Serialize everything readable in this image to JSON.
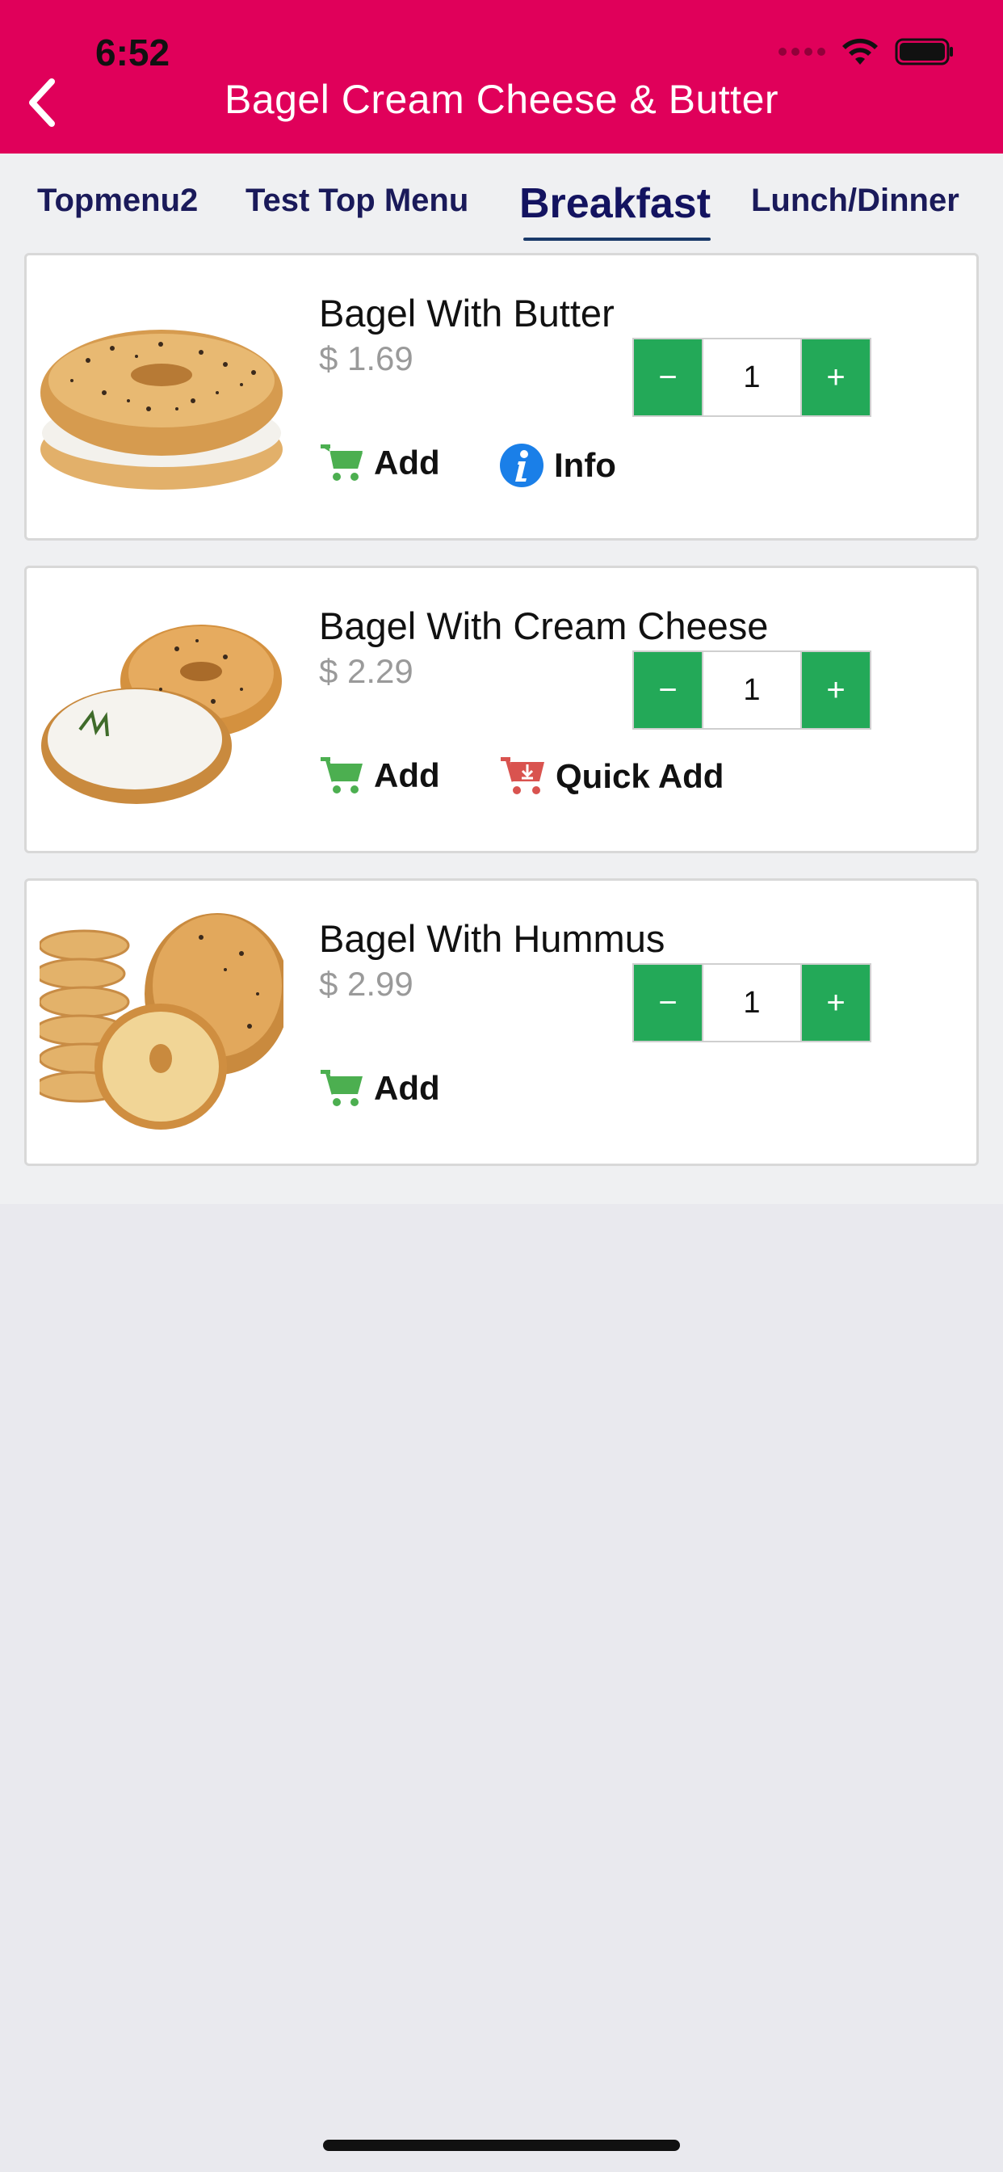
{
  "status_bar": {
    "time": "6:52"
  },
  "header": {
    "title": "Bagel Cream Cheese & Butter"
  },
  "tabs": [
    {
      "label": "Topmenu2"
    },
    {
      "label": "Test Top Menu"
    },
    {
      "label": "Breakfast"
    },
    {
      "label": "Lunch/Dinner"
    }
  ],
  "active_tab": "Breakfast",
  "items": [
    {
      "name": "Bagel With Butter",
      "price": "$ 1.69",
      "quantity": "1",
      "add_label": "Add",
      "extra_label": "Info"
    },
    {
      "name": "Bagel With Cream Cheese",
      "price": "$ 2.29",
      "quantity": "1",
      "add_label": "Add",
      "extra_label": "Quick Add"
    },
    {
      "name": "Bagel With Hummus",
      "price": "$ 2.99",
      "quantity": "1",
      "add_label": "Add"
    }
  ],
  "stepper": {
    "minus": "−",
    "plus": "+"
  },
  "colors": {
    "header": "#e0005a",
    "stepper_green": "#23a958",
    "cart_green": "#4caf50",
    "quick_add_red": "#d9534f",
    "info_blue": "#1a7fe8"
  },
  "icons": {
    "back": "chevron-left-icon",
    "wifi": "wifi-icon",
    "battery": "battery-icon",
    "cart": "cart-icon",
    "info": "info-icon",
    "quick_add": "cart-download-icon"
  }
}
